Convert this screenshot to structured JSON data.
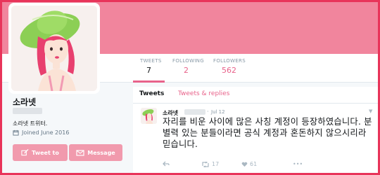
{
  "profile": {
    "name": "소라넷",
    "bio": "소라넷 트위터.",
    "joined": "Joined June 2016",
    "tweet_button": "Tweet to",
    "message_button": "Message"
  },
  "stats": [
    {
      "label": "TWEETS",
      "value": "7"
    },
    {
      "label": "FOLLOWING",
      "value": "2"
    },
    {
      "label": "FOLLOWERS",
      "value": "562"
    }
  ],
  "tabs": {
    "tweets": "Tweets",
    "replies": "Tweets & replies"
  },
  "tweet": {
    "author": "소라넷",
    "date": "Jul 12",
    "text": "자리를 비운 사이에 많은 사칭 계정이 등장하였습니다. 분별력 있는 분들이라면 공식 계정과 혼돈하지 않으시리라 믿습니다.",
    "retweets": "17",
    "likes": "61"
  },
  "colors": {
    "brand": "#f1859d",
    "accent": "#e8628a",
    "button": "#f19aad",
    "frame": "#e8345a"
  },
  "icons": {
    "calendar": "calendar-icon",
    "tweet_to": "compose-icon",
    "message": "envelope-icon",
    "reply": "reply-icon",
    "retweet": "retweet-icon",
    "like": "heart-icon",
    "more": "more-icon"
  }
}
